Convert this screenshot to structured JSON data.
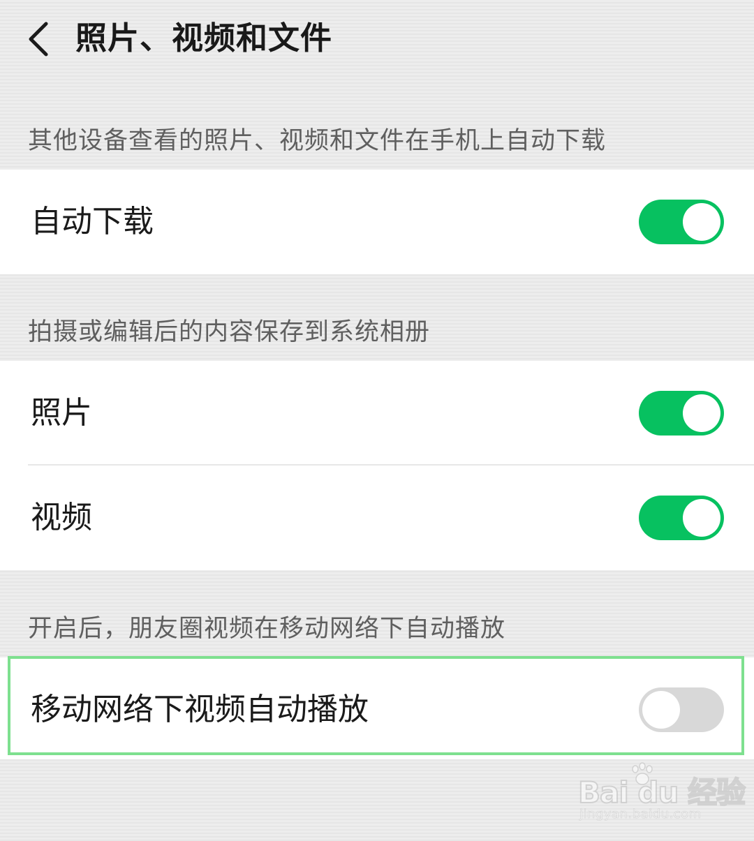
{
  "header": {
    "title": "照片、视频和文件",
    "back_icon": "chevron-left-icon"
  },
  "sections": [
    {
      "caption": "其他设备查看的照片、视频和文件在手机上自动下载",
      "items": [
        {
          "label": "自动下载",
          "enabled": true
        }
      ]
    },
    {
      "caption": "拍摄或编辑后的内容保存到系统相册",
      "items": [
        {
          "label": "照片",
          "enabled": true
        },
        {
          "label": "视频",
          "enabled": true
        }
      ]
    },
    {
      "caption": "开启后，朋友圈视频在移动网络下自动播放",
      "items": [
        {
          "label": "移动网络下视频自动播放",
          "enabled": false
        }
      ]
    }
  ],
  "colors": {
    "toggle_on": "#07c160",
    "toggle_off": "#d8d8d8",
    "highlight_border": "#7ee08f"
  },
  "watermark": {
    "logo_text": "Bai du 经验",
    "url": "jingyan.baidu.com"
  }
}
